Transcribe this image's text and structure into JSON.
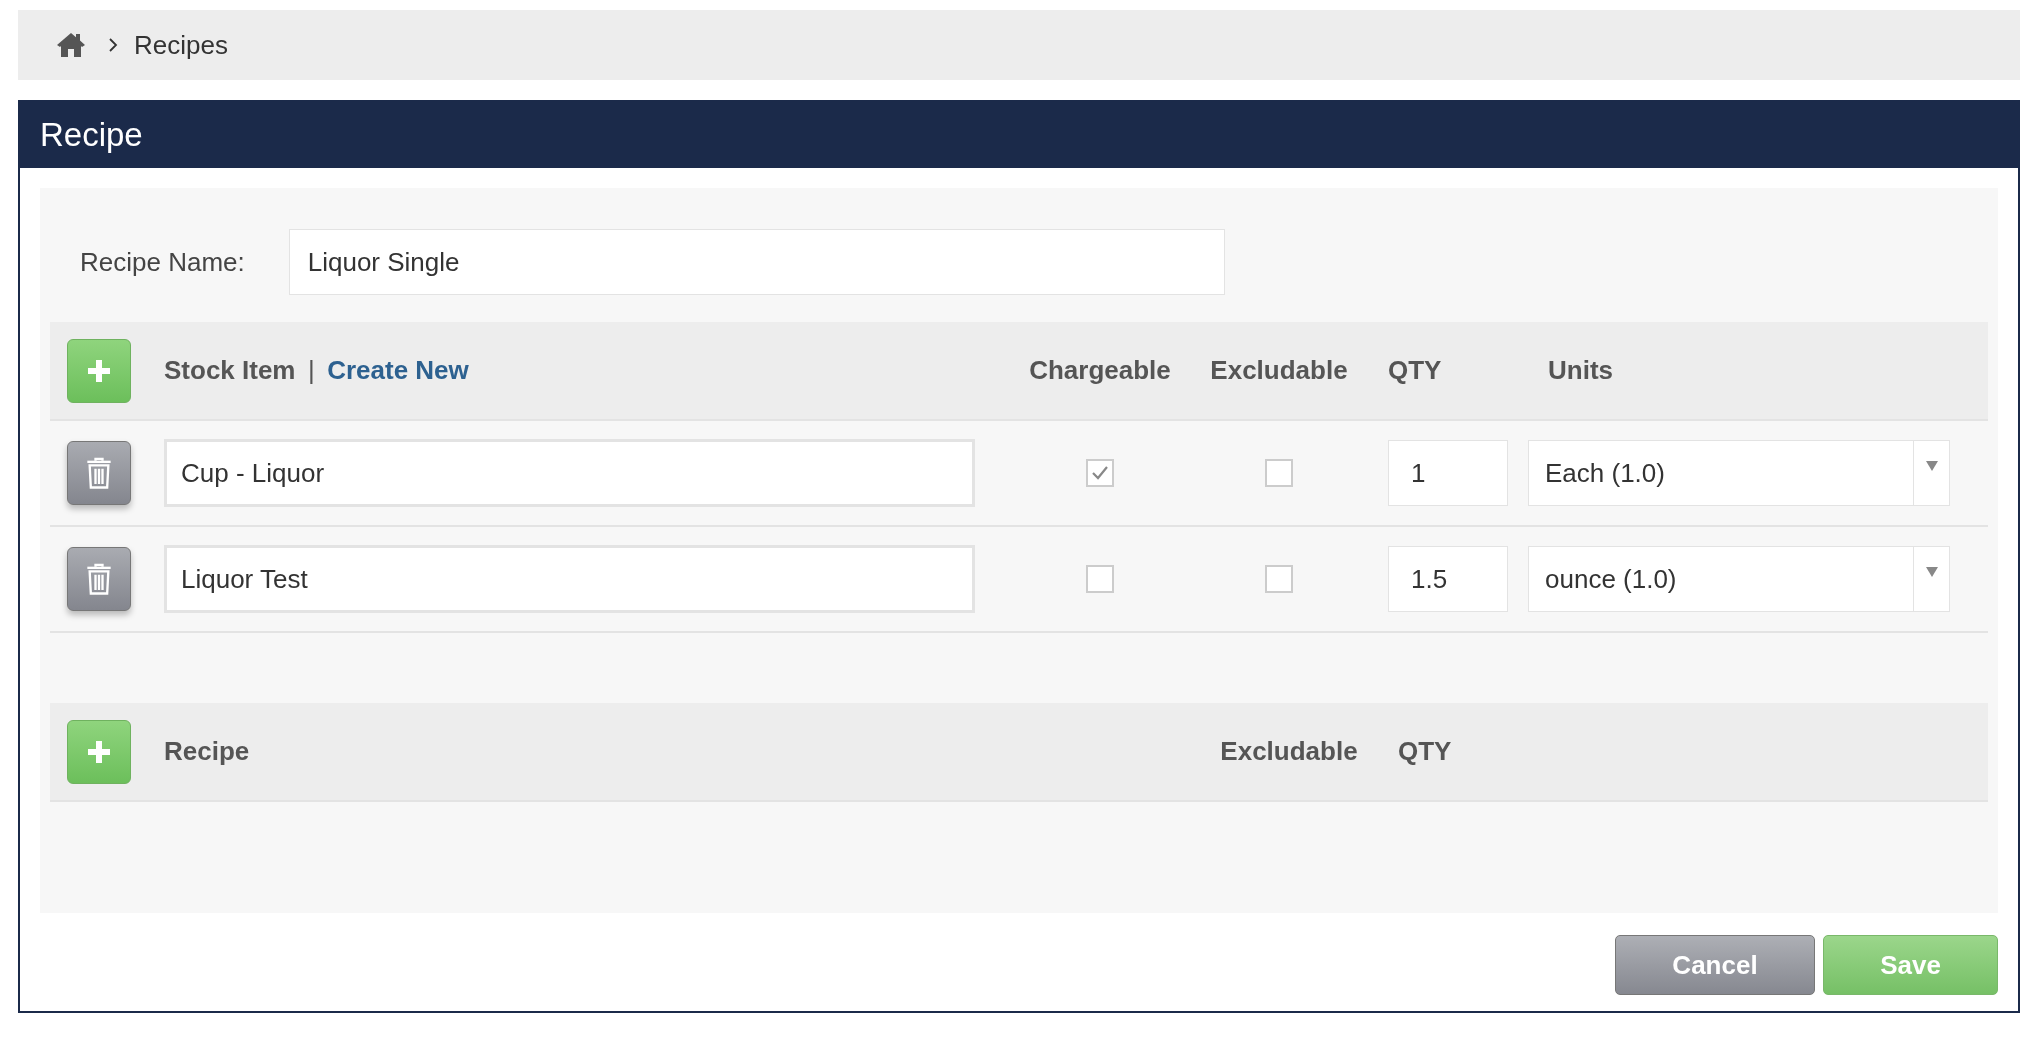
{
  "breadcrumb": {
    "items": [
      "Recipes"
    ]
  },
  "panel": {
    "title": "Recipe"
  },
  "recipe_name": {
    "label": "Recipe Name:",
    "value": "Liquor Single"
  },
  "stock_items": {
    "columns": {
      "item": "Stock Item",
      "separator": "|",
      "create_link": "Create New",
      "chargeable": "Chargeable",
      "excludable": "Excludable",
      "qty": "QTY",
      "units": "Units"
    },
    "rows": [
      {
        "name": "Cup - Liquor",
        "chargeable": true,
        "excludable": false,
        "qty": "1",
        "units": "Each (1.0)"
      },
      {
        "name": "Liquor Test",
        "chargeable": false,
        "excludable": false,
        "qty": "1.5",
        "units": "ounce (1.0)"
      }
    ]
  },
  "recipes": {
    "columns": {
      "recipe": "Recipe",
      "excludable": "Excludable",
      "qty": "QTY"
    }
  },
  "buttons": [
    {
      "kind": "cancel",
      "label": "Cancel"
    },
    {
      "kind": "save",
      "label": "Save"
    }
  ]
}
